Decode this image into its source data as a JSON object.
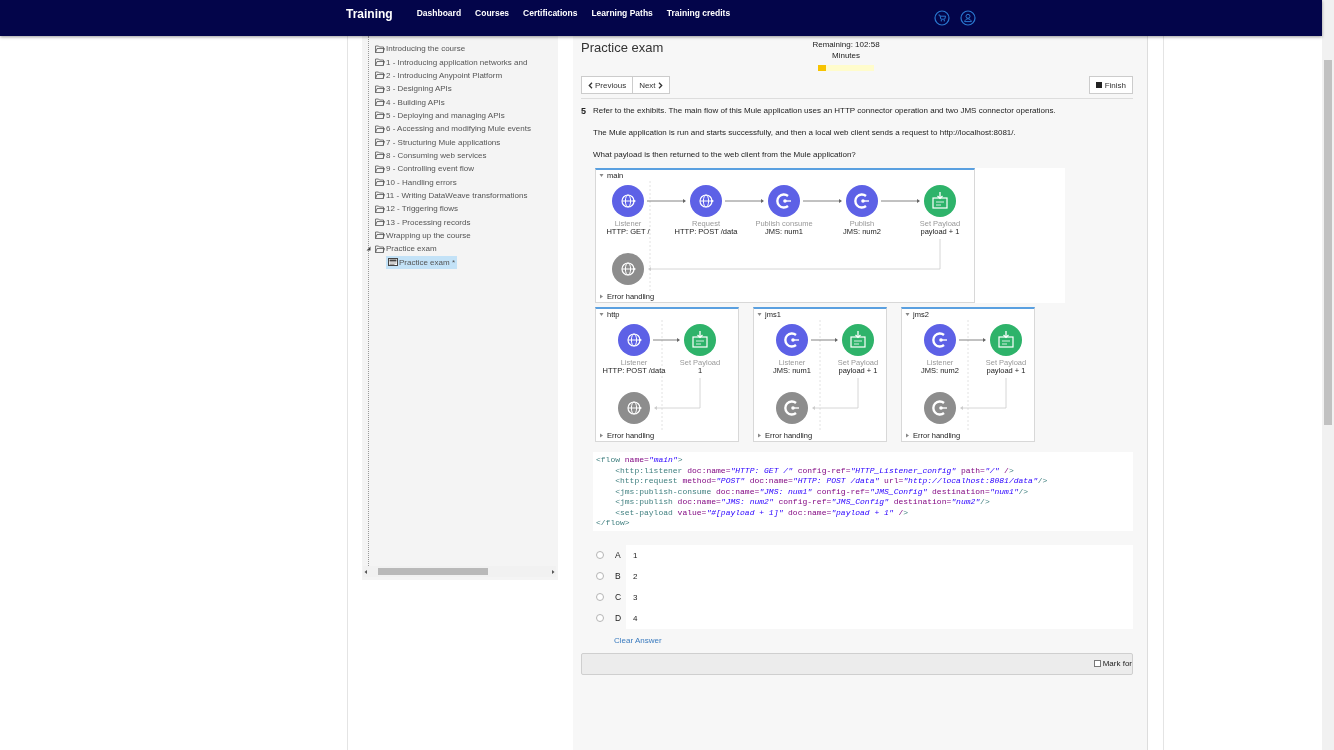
{
  "nav": {
    "brand": "Training",
    "links": [
      "Dashboard",
      "Courses",
      "Certifications",
      "Learning Paths",
      "Training credits"
    ]
  },
  "sidebar": {
    "tree": [
      {
        "label": "Introducing the course",
        "kind": "folder",
        "selected": false,
        "expanded": false
      },
      {
        "label": "1 - Introducing application networks and",
        "kind": "folder",
        "selected": false,
        "expanded": false
      },
      {
        "label": "2 - Introducing Anypoint Platform",
        "kind": "folder",
        "selected": false,
        "expanded": false
      },
      {
        "label": "3 - Designing APIs",
        "kind": "folder",
        "selected": false,
        "expanded": false
      },
      {
        "label": "4 - Building APIs",
        "kind": "folder",
        "selected": false,
        "expanded": false
      },
      {
        "label": "5 - Deploying and managing APIs",
        "kind": "folder",
        "selected": false,
        "expanded": false
      },
      {
        "label": "6 - Accessing and modifying Mule events",
        "kind": "folder",
        "selected": false,
        "expanded": false
      },
      {
        "label": "7 - Structuring Mule applications",
        "kind": "folder",
        "selected": false,
        "expanded": false
      },
      {
        "label": "8 - Consuming web services",
        "kind": "folder",
        "selected": false,
        "expanded": false
      },
      {
        "label": "9 - Controlling event flow",
        "kind": "folder",
        "selected": false,
        "expanded": false
      },
      {
        "label": "10 - Handling errors",
        "kind": "folder",
        "selected": false,
        "expanded": false
      },
      {
        "label": "11 - Writing DataWeave transformations",
        "kind": "folder",
        "selected": false,
        "expanded": false
      },
      {
        "label": "12 - Triggering flows",
        "kind": "folder",
        "selected": false,
        "expanded": false
      },
      {
        "label": "13 - Processing records",
        "kind": "folder",
        "selected": false,
        "expanded": false
      },
      {
        "label": "Wrapping up the course",
        "kind": "folder",
        "selected": false,
        "expanded": false
      },
      {
        "label": "Practice exam",
        "kind": "folder",
        "selected": false,
        "expanded": true,
        "children": [
          {
            "label": "Practice exam *",
            "kind": "page",
            "selected": true,
            "expanded": false
          }
        ]
      }
    ]
  },
  "exam": {
    "title": "Practice exam",
    "timer": {
      "remaining": "Remaining: 102:58",
      "unit": "Minutes",
      "level": 0.14
    },
    "previous": "Previous",
    "next": "Next",
    "finish": "Finish"
  },
  "question": {
    "number": "5",
    "paragraphs": [
      "Refer to the exhibits. The main flow of this Mule application uses an HTTP connector operation and two JMS connector operations.",
      "The Mule application is run and starts successfully, and then a local web client sends a request to http://localhost:8081/.",
      "What payload is then returned to the web client from the Mule application?"
    ],
    "flows": [
      {
        "name": "main",
        "expanded": true,
        "nodes": [
          {
            "kind": "http",
            "type": "Listener",
            "label": "HTTP: GET /"
          },
          {
            "kind": "http",
            "type": "Request",
            "label": "HTTP: POST /data"
          },
          {
            "kind": "jms",
            "type": "Publish consume",
            "label": "JMS: num1"
          },
          {
            "kind": "jms",
            "type": "Publish",
            "label": "JMS: num2"
          },
          {
            "kind": "payload",
            "type": "Set Payload",
            "label": "payload + 1"
          }
        ],
        "error_node": {
          "kind": "http"
        },
        "error_label": "Error handling",
        "error_expanded": false
      },
      {
        "name": "http",
        "expanded": true,
        "nodes": [
          {
            "kind": "http",
            "type": "Listener",
            "label": "HTTP: POST /data"
          },
          {
            "kind": "payload",
            "type": "Set Payload",
            "label": "1"
          }
        ],
        "error_node": {
          "kind": "http"
        },
        "error_label": "Error handling",
        "error_expanded": false
      },
      {
        "name": "jms1",
        "expanded": true,
        "nodes": [
          {
            "kind": "jms",
            "type": "Listener",
            "label": "JMS: num1"
          },
          {
            "kind": "payload",
            "type": "Set Payload",
            "label": "payload + 1"
          }
        ],
        "error_node": {
          "kind": "jms"
        },
        "error_label": "Error handling",
        "error_expanded": false
      },
      {
        "name": "jms2",
        "expanded": true,
        "nodes": [
          {
            "kind": "jms",
            "type": "Listener",
            "label": "JMS: num2"
          },
          {
            "kind": "payload",
            "type": "Set Payload",
            "label": "payload + 1"
          }
        ],
        "error_node": {
          "kind": "jms"
        },
        "error_label": "Error handling",
        "error_expanded": false
      }
    ],
    "code": [
      "<flow name=\"main\">",
      "    <http:listener doc:name=\"HTTP: GET /\" config-ref=\"HTTP_Listener_config\" path=\"/\" />",
      "    <http:request method=\"POST\" doc:name=\"HTTP: POST /data\" url=\"http://localhost:8081/data\"/>",
      "    <jms:publish-consume doc:name=\"JMS: num1\" config-ref=\"JMS_Config\" destination=\"num1\"/>",
      "    <jms:publish doc:name=\"JMS: num2\" config-ref=\"JMS_Config\" destination=\"num2\"/>",
      "    <set-payload value=\"#[payload + 1]\" doc:name=\"payload + 1\" />",
      "</flow>"
    ],
    "answers": [
      {
        "letter": "A",
        "text": "1",
        "selected": false
      },
      {
        "letter": "B",
        "text": "2",
        "selected": false
      },
      {
        "letter": "C",
        "text": "3",
        "selected": false
      },
      {
        "letter": "D",
        "text": "4",
        "selected": false
      }
    ],
    "clear": "Clear Answer"
  },
  "footer": {
    "mark_label": "Mark for",
    "checked": false
  }
}
